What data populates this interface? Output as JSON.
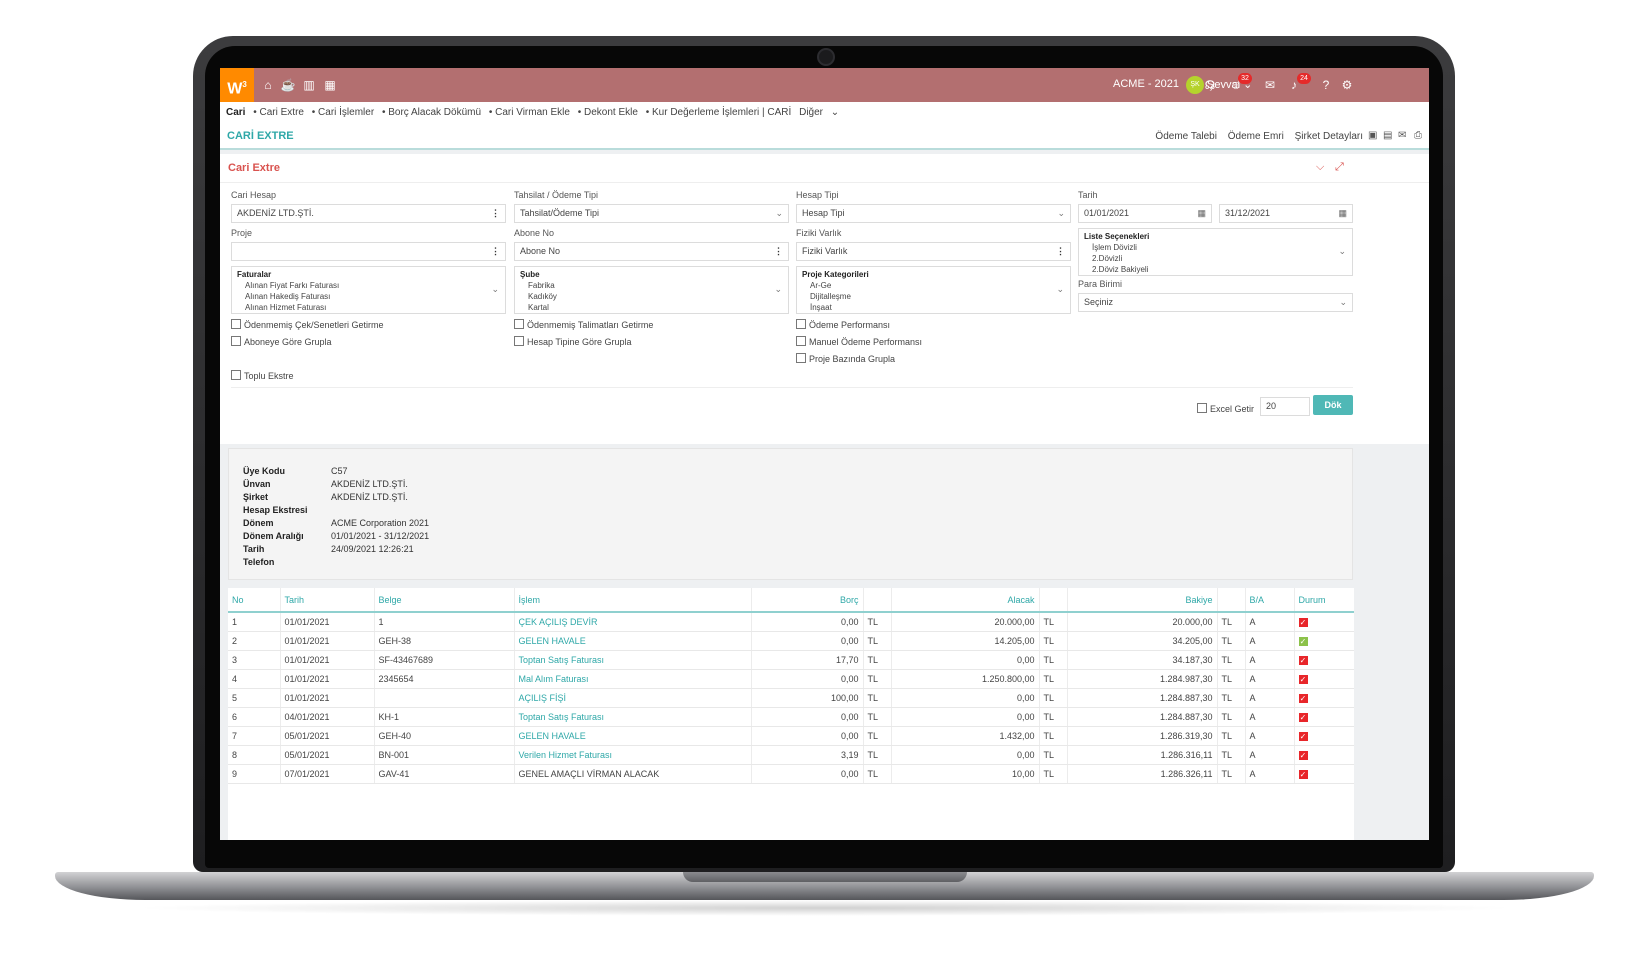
{
  "topbar": {
    "logo": "W",
    "logo_sup": "3",
    "company": "ACME - 2021",
    "user_initials": "ŞK",
    "user_name": "Şevval",
    "badge_messages": "32",
    "badge_notifications": "24"
  },
  "breadcrumb": [
    "Cari",
    "• Cari Extre",
    "• Cari İşlemler",
    "• Borç Alacak Dökümü",
    "• Cari Virman Ekle",
    "• Dekont Ekle",
    "• Kur Değerleme İşlemleri | CARİ",
    "Diğer"
  ],
  "page": {
    "title": "CARİ EXTRE",
    "links": [
      "Ödeme Talebi",
      "Ödeme Emri",
      "Şirket Detayları"
    ]
  },
  "panel": {
    "title": "Cari Extre",
    "labels": {
      "cari_hesap": "Cari Hesap",
      "tahsilat": "Tahsilat / Ödeme Tipi",
      "hesap_tipi": "Hesap Tipi",
      "tarih": "Tarih",
      "proje": "Proje",
      "abone_no": "Abone No",
      "fiziki_varlik": "Fiziki Varlık",
      "para_birimi": "Para Birimi"
    },
    "values": {
      "cari_hesap": "AKDENİZ LTD.ŞTİ.",
      "tahsilat": "Tahsilat/Ödeme Tipi",
      "hesap_tipi": "Hesap Tipi",
      "tarih_from": "01/01/2021",
      "tarih_to": "31/12/2021",
      "abone_no": "Abone No",
      "fiziki_varlik": "Fiziki Varlık",
      "para_birimi": "Seçiniz"
    },
    "lists": {
      "faturalar": {
        "header": "Faturalar",
        "items": [
          "Alınan Fiyat Farkı Faturası",
          "Alınan Hakediş Faturası",
          "Alınan Hizmet Faturası"
        ]
      },
      "sube": {
        "header": "Şube",
        "items": [
          "Fabrika",
          "Kadıköy",
          "Kartal"
        ]
      },
      "proje_kategorileri": {
        "header": "Proje Kategorileri",
        "items": [
          "Ar-Ge",
          "Dijitalleşme",
          "İnşaat"
        ]
      },
      "liste_secenekleri": {
        "header": "Liste Seçenekleri",
        "items": [
          "İşlem Dövizli",
          "2.Dövizli",
          "2.Döviz Bakiyeli"
        ]
      }
    },
    "checkboxes": {
      "odenmemis_cek": "Ödenmemiş Çek/Senetleri Getirme",
      "aboneye_gore": "Aboneye Göre Grupla",
      "toplu_ekstre": "Toplu Ekstre",
      "odenmemis_talimat": "Ödenmemiş Talimatları Getirme",
      "hesap_tipine_gore": "Hesap Tipine Göre Grupla",
      "odeme_performansi": "Ödeme Performansı",
      "manuel_odeme": "Manuel Ödeme Performansı",
      "proje_bazinda": "Proje Bazında Grupla",
      "excel_getir": "Excel Getir"
    },
    "max_rows": "20",
    "dok_label": "Dök"
  },
  "info": {
    "keys": [
      "Üye Kodu",
      "Ünvan",
      "Şirket",
      "Hesap Ekstresi",
      "Dönem",
      "Dönem Aralığı",
      "Tarih",
      "Telefon"
    ],
    "values": [
      "C57",
      "AKDENİZ LTD.ŞTİ.",
      "AKDENİZ LTD.ŞTİ.",
      "",
      "ACME Corporation 2021",
      "01/01/2021 - 31/12/2021",
      "24/09/2021 12:26:21",
      ""
    ]
  },
  "table": {
    "columns": [
      "No",
      "Tarih",
      "Belge",
      "İşlem",
      "Borç",
      "",
      "Alacak",
      "",
      "Bakiye",
      "",
      "B/A",
      "Durum"
    ],
    "rows": [
      {
        "no": "1",
        "tarih": "01/01/2021",
        "belge": "1",
        "islem": "ÇEK AÇILIŞ DEVİR",
        "link": true,
        "borc": "0,00",
        "bc": "TL",
        "alacak": "20.000,00",
        "ac": "TL",
        "bakiye": "20.000,00",
        "kc": "TL",
        "ba": "A",
        "durum": "red"
      },
      {
        "no": "2",
        "tarih": "01/01/2021",
        "belge": "GEH-38",
        "islem": "GELEN HAVALE",
        "link": true,
        "borc": "0,00",
        "bc": "TL",
        "alacak": "14.205,00",
        "ac": "TL",
        "bakiye": "34.205,00",
        "kc": "TL",
        "ba": "A",
        "durum": "green"
      },
      {
        "no": "3",
        "tarih": "01/01/2021",
        "belge": "SF-43467689",
        "islem": "Toptan Satış Faturası",
        "link": true,
        "borc": "17,70",
        "bc": "TL",
        "alacak": "0,00",
        "ac": "TL",
        "bakiye": "34.187,30",
        "kc": "TL",
        "ba": "A",
        "durum": "red"
      },
      {
        "no": "4",
        "tarih": "01/01/2021",
        "belge": "2345654",
        "islem": "Mal Alım Faturası",
        "link": true,
        "borc": "0,00",
        "bc": "TL",
        "alacak": "1.250.800,00",
        "ac": "TL",
        "bakiye": "1.284.987,30",
        "kc": "TL",
        "ba": "A",
        "durum": "red"
      },
      {
        "no": "5",
        "tarih": "01/01/2021",
        "belge": "",
        "islem": "AÇILIŞ FİŞİ",
        "link": true,
        "borc": "100,00",
        "bc": "TL",
        "alacak": "0,00",
        "ac": "TL",
        "bakiye": "1.284.887,30",
        "kc": "TL",
        "ba": "A",
        "durum": "red"
      },
      {
        "no": "6",
        "tarih": "04/01/2021",
        "belge": "KH-1",
        "islem": "Toptan Satış Faturası",
        "link": true,
        "borc": "0,00",
        "bc": "TL",
        "alacak": "0,00",
        "ac": "TL",
        "bakiye": "1.284.887,30",
        "kc": "TL",
        "ba": "A",
        "durum": "red"
      },
      {
        "no": "7",
        "tarih": "05/01/2021",
        "belge": "GEH-40",
        "islem": "GELEN HAVALE",
        "link": true,
        "borc": "0,00",
        "bc": "TL",
        "alacak": "1.432,00",
        "ac": "TL",
        "bakiye": "1.286.319,30",
        "kc": "TL",
        "ba": "A",
        "durum": "red"
      },
      {
        "no": "8",
        "tarih": "05/01/2021",
        "belge": "BN-001",
        "islem": "Verilen Hizmet Faturası",
        "link": true,
        "borc": "3,19",
        "bc": "TL",
        "alacak": "0,00",
        "ac": "TL",
        "bakiye": "1.286.316,11",
        "kc": "TL",
        "ba": "A",
        "durum": "red"
      },
      {
        "no": "9",
        "tarih": "07/01/2021",
        "belge": "GAV-41",
        "islem": "GENEL AMAÇLI VİRMAN ALACAK",
        "link": false,
        "borc": "0,00",
        "bc": "TL",
        "alacak": "10,00",
        "ac": "TL",
        "bakiye": "1.286.326,11",
        "kc": "TL",
        "ba": "A",
        "durum": "red"
      }
    ]
  }
}
